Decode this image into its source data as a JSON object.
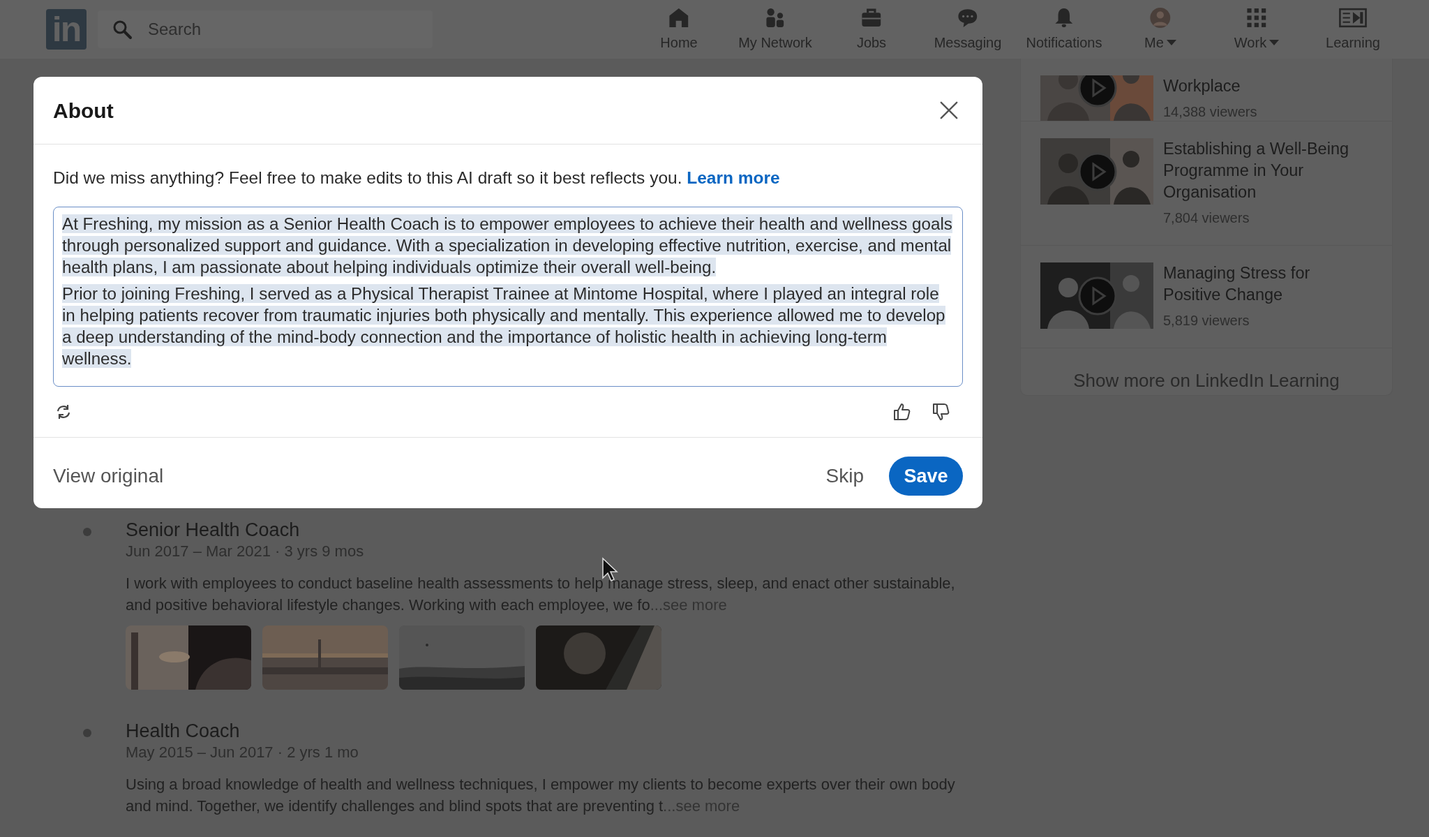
{
  "nav": {
    "logo": "in",
    "search": {
      "placeholder": "Search"
    },
    "items": [
      {
        "label": "Home",
        "kind": "home",
        "dropdown": false
      },
      {
        "label": "My Network",
        "kind": "network",
        "dropdown": false
      },
      {
        "label": "Jobs",
        "kind": "jobs",
        "dropdown": false
      },
      {
        "label": "Messaging",
        "kind": "messaging",
        "dropdown": false
      },
      {
        "label": "Notifications",
        "kind": "bell",
        "dropdown": false
      },
      {
        "label": "Me",
        "kind": "avatar",
        "dropdown": true
      },
      {
        "label": "Work",
        "kind": "grid",
        "dropdown": true
      },
      {
        "label": "Learning",
        "kind": "learning",
        "dropdown": false
      }
    ]
  },
  "modal": {
    "title": "About",
    "intro": "Did we miss anything? Feel free to make edits to this AI draft so it best reflects you.",
    "intro_link": "Learn more",
    "draft": {
      "text_selected": true,
      "paragraphs": [
        "At Freshing, my mission as a Senior Health Coach is to empower employees to achieve their health and wellness goals through personalized support and guidance. With a specialization in developing effective nutrition, exercise, and mental health plans, I am passionate about helping individuals optimize their overall well-being.",
        "Prior to joining Freshing, I served as a Physical Therapist Trainee at Mintome Hospital, where I played an integral role in helping patients recover from traumatic injuries both physically and mentally. This experience allowed me to develop a deep understanding of the mind-body connection and the importance of holistic health in achieving long-term wellness."
      ]
    },
    "view_original": "View original",
    "skip": "Skip",
    "save": "Save"
  },
  "experience": [
    {
      "title": "Senior Health Coach",
      "dates": "Jun 2017 – Mar 2021  ·  3 yrs 9 mos",
      "description": "I work with employees to conduct baseline health assessments to help manage stress, sleep, and enact other sustainable, and positive behavioral lifestyle changes. Working with each employee, we fo",
      "see_more": "...see more"
    },
    {
      "title": "Health Coach",
      "dates": "May 2015 – Jun 2017  ·  2 yrs 1 mo",
      "description": "Using a broad knowledge of health and wellness techniques, I empower my clients to become experts over their own body and mind. Together, we identify challenges and blind spots that are preventing t",
      "see_more": "...see more"
    }
  ],
  "learning": {
    "courses": [
      {
        "title": "Workplace",
        "viewers": "14,388 viewers"
      },
      {
        "title": "Establishing a Well-Being Programme in Your Organisation",
        "viewers": "7,804 viewers"
      },
      {
        "title": "Managing Stress for Positive Change",
        "viewers": "5,819 viewers"
      }
    ],
    "show_more": "Show more on LinkedIn Learning"
  }
}
